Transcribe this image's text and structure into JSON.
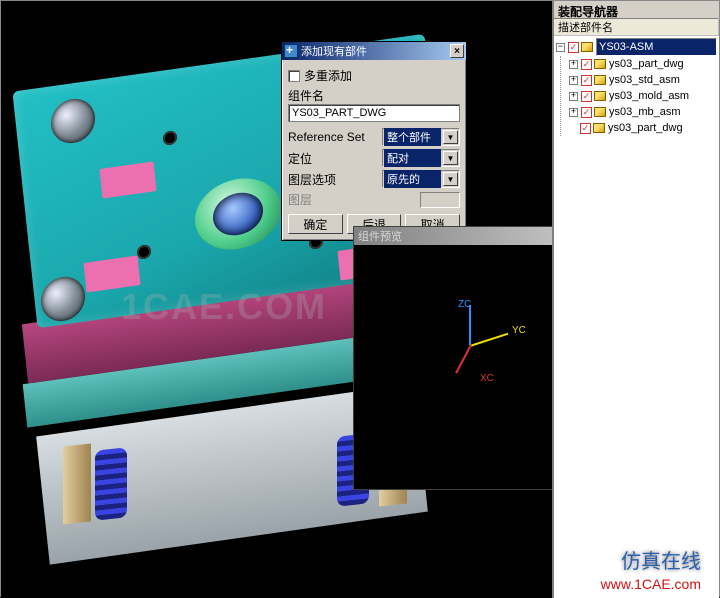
{
  "dialog": {
    "title": "添加现有部件",
    "multi_add_label": "多重添加",
    "component_name_label": "组件名",
    "component_name_value": "YS03_PART_DWG",
    "ref_set_label": "Reference Set",
    "ref_set_value": "整个部件",
    "position_label": "定位",
    "position_value": "配对",
    "layer_opt_label": "图层选项",
    "layer_opt_value": "原先的",
    "layer_label": "图层",
    "ok_label": "确定",
    "back_label": "后退",
    "cancel_label": "取消"
  },
  "preview": {
    "title": "组件预览",
    "axes": {
      "x": "XC",
      "y": "YC",
      "z": "ZC"
    }
  },
  "right_panel": {
    "title": "装配导航器",
    "header": "描述部件名",
    "root": "YS03-ASM",
    "children": [
      "ys03_part_dwg",
      "ys03_std_asm",
      "ys03_mold_asm",
      "ys03_mb_asm",
      "ys03_part_dwg"
    ]
  },
  "watermark": "1CAE.COM",
  "footer_cn": "仿真在线",
  "footer_url": "www.1CAE.com"
}
